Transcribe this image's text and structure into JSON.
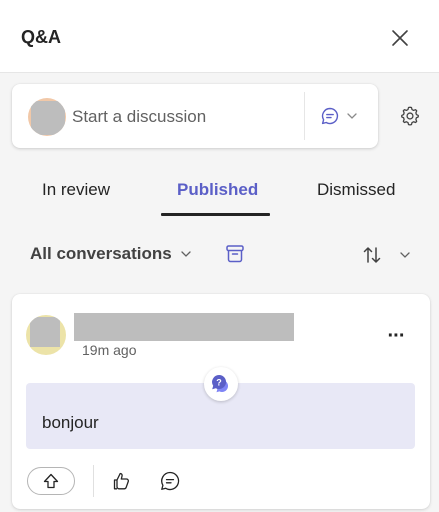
{
  "header": {
    "title": "Q&A",
    "close_icon": "close-icon"
  },
  "composer": {
    "placeholder": "Start a discussion",
    "type_icon": "chat-bubble-icon",
    "settings_icon": "gear-icon"
  },
  "tabs": [
    {
      "label": "In review",
      "active": false
    },
    {
      "label": "Published",
      "active": true
    },
    {
      "label": "Dismissed",
      "active": false
    }
  ],
  "filter": {
    "label": "All conversations",
    "archive_icon": "archive-icon",
    "sort_icon": "sort-icon"
  },
  "post": {
    "time": "19m ago",
    "badge_icon": "question-icon",
    "message": "bonjour",
    "more_label": "···"
  },
  "colors": {
    "accent": "#5b5fc7",
    "message_bg": "#e8e8f6",
    "background": "#f5f5f5"
  }
}
